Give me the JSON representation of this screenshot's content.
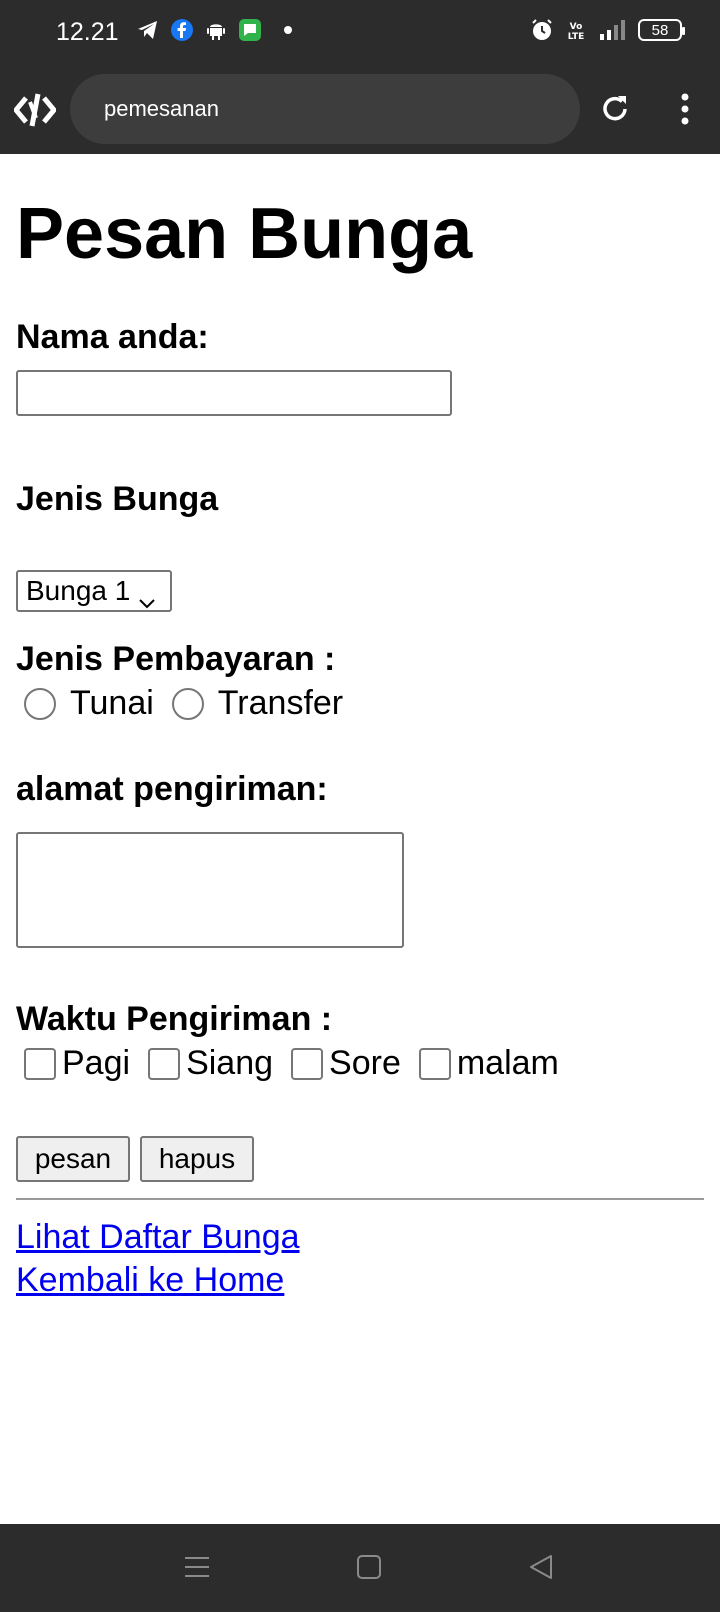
{
  "status_bar": {
    "time": "12.21",
    "left_icons": [
      "telegram-icon",
      "facebook-icon",
      "android-icon",
      "messages-icon",
      "dot-icon"
    ],
    "right_icons": [
      "alarm-icon",
      "volte-icon",
      "signal-icon"
    ],
    "battery": "58"
  },
  "browser": {
    "url": "pemesanan"
  },
  "form": {
    "title": "Pesan Bunga",
    "name_label": "Nama anda:",
    "name_value": "",
    "flower_type_label": "Jenis Bunga",
    "flower_type_selected": "Bunga 1",
    "payment_label": "Jenis Pembayaran :",
    "payment_options": [
      "Tunai",
      "Transfer"
    ],
    "address_label": "alamat pengiriman:",
    "address_value": "",
    "time_label": "Waktu Pengiriman :",
    "time_options": [
      "Pagi",
      "Siang",
      "Sore",
      "malam"
    ],
    "submit_label": "pesan",
    "reset_label": "hapus"
  },
  "links": {
    "flower_list": "Lihat Daftar Bunga",
    "home": "Kembali ke Home"
  },
  "colors": {
    "system_bar": "#2c2c2c",
    "url_pill": "#3d3d3d",
    "link": "#0000ee",
    "facebook": "#1877f2",
    "messages": "#2fb34a"
  }
}
